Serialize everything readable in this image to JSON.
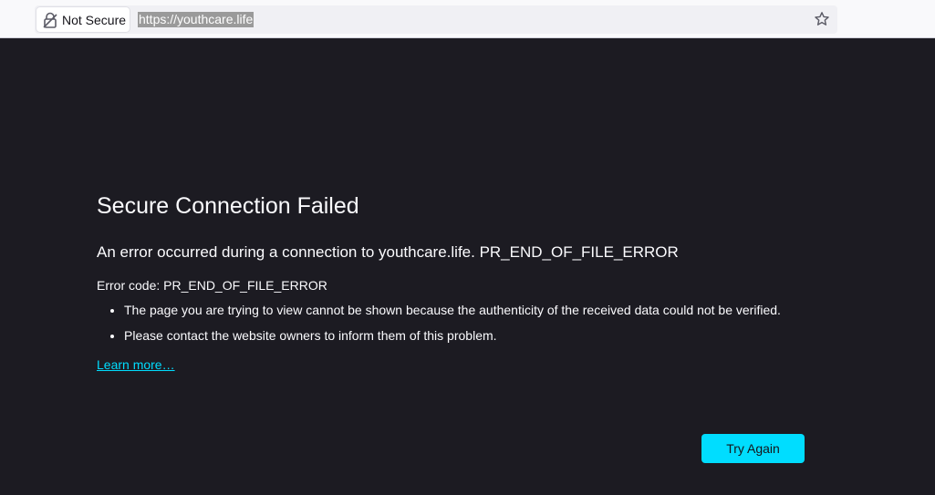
{
  "browser": {
    "identity_label": "Not Secure",
    "url": "https://youthcare.life",
    "icons": {
      "identity": "insecure-lock-icon",
      "bookmark": "star-icon"
    }
  },
  "error_page": {
    "title": "Secure Connection Failed",
    "short_description": "An error occurred during a connection to youthcare.life. PR_END_OF_FILE_ERROR",
    "error_code": "Error code: PR_END_OF_FILE_ERROR",
    "details": [
      "The page you are trying to view cannot be shown because the authenticity of the received data could not be verified.",
      "Please contact the website owners to inform them of this problem."
    ],
    "learn_more_label": "Learn more…",
    "try_again_label": "Try Again"
  },
  "colors": {
    "page_background": "#1c1b22",
    "text": "#fbfbfe",
    "accent": "#00ddff",
    "toolbar_background": "#f9f9fb"
  }
}
